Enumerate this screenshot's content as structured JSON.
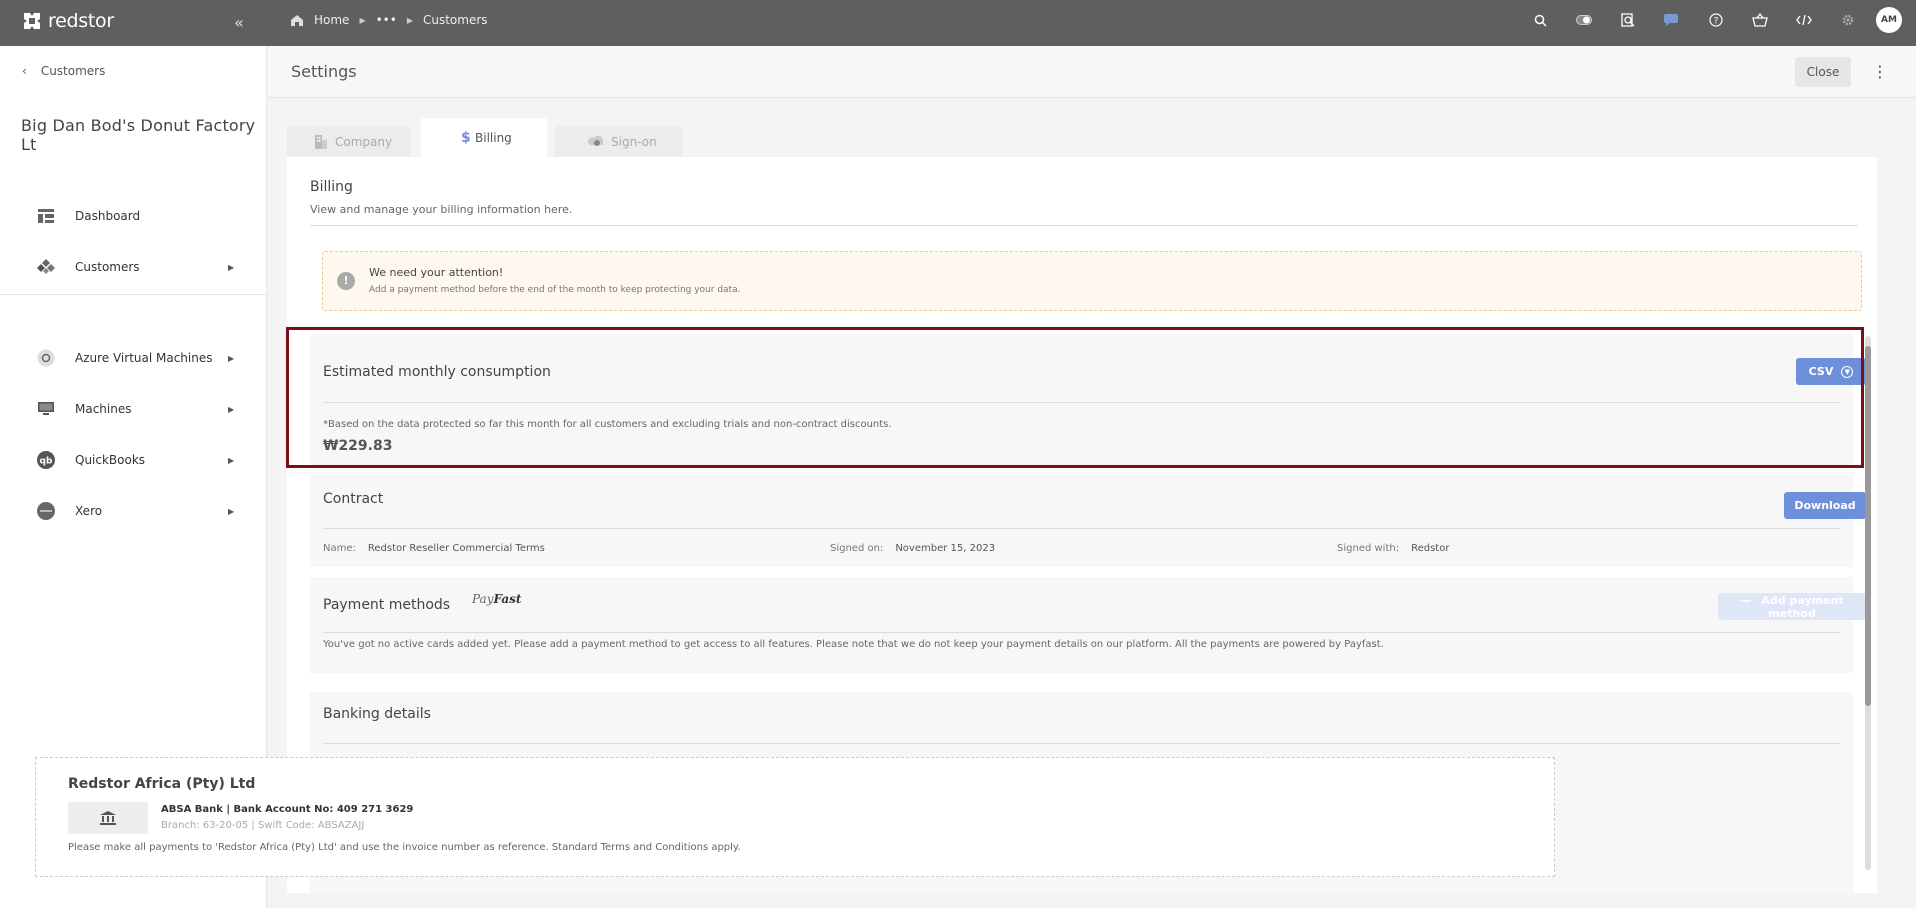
{
  "topbar": {
    "logo_text": "redstor",
    "breadcrumbs": [
      "Home",
      "•••",
      "Customers"
    ],
    "avatar_initials": "AM",
    "icons": [
      "search-icon",
      "toggle-icon",
      "search-document-icon",
      "chat-icon",
      "help-icon",
      "basket-icon",
      "code-icon",
      "gear-icon"
    ]
  },
  "sidebar": {
    "back_label": "Customers",
    "company_name": "Big Dan Bod's Donut Factory Lt",
    "items": [
      {
        "label": "Dashboard"
      },
      {
        "label": "Customers"
      },
      {
        "label": "Azure Virtual Machines"
      },
      {
        "label": "Machines"
      },
      {
        "label": "QuickBooks"
      },
      {
        "label": "Xero"
      }
    ]
  },
  "header": {
    "title": "Settings",
    "close_label": "Close"
  },
  "tabs": [
    {
      "label": "Company"
    },
    {
      "label": "Billing"
    },
    {
      "label": "Sign-on"
    }
  ],
  "billing": {
    "title": "Billing",
    "subtitle": "View and manage your billing information here."
  },
  "alert": {
    "title": "We need your attention!",
    "message": "Add a payment method before the end of the month to keep protecting your data."
  },
  "consumption": {
    "title": "Estimated monthly consumption",
    "csv_label": "CSV",
    "note": "*Based on the data protected so far this month for all customers and excluding trials and non-contract discounts.",
    "amount": "₩229.83"
  },
  "contract": {
    "title": "Contract",
    "download_label": "Download",
    "name_label": "Name:",
    "name_value": "Redstor Reseller Commercial Terms",
    "signed_on_label": "Signed on:",
    "signed_on_value": "November 15, 2023",
    "signed_with_label": "Signed with:",
    "signed_with_value": "Redstor"
  },
  "payment": {
    "title": "Payment methods",
    "provider_logo_pre": "Pay",
    "provider_logo_post": "Fast",
    "add_label": "Add payment method",
    "message": "You've got no active cards added yet. Please add a payment method to get access to all features. Please note that we do not keep your payment details on our platform. All the payments are powered by Payfast."
  },
  "banking": {
    "title": "Banking details",
    "company": "Redstor Africa (Pty) Ltd",
    "line1": "ABSA Bank | Bank Account No: 409 271 3629",
    "line2": "Branch: 63-20-05 | Swift Code: ABSAZAJJ",
    "note": "Please make all payments to 'Redstor Africa (Pty) Ltd' and use the invoice number as reference. Standard Terms and Conditions apply."
  }
}
